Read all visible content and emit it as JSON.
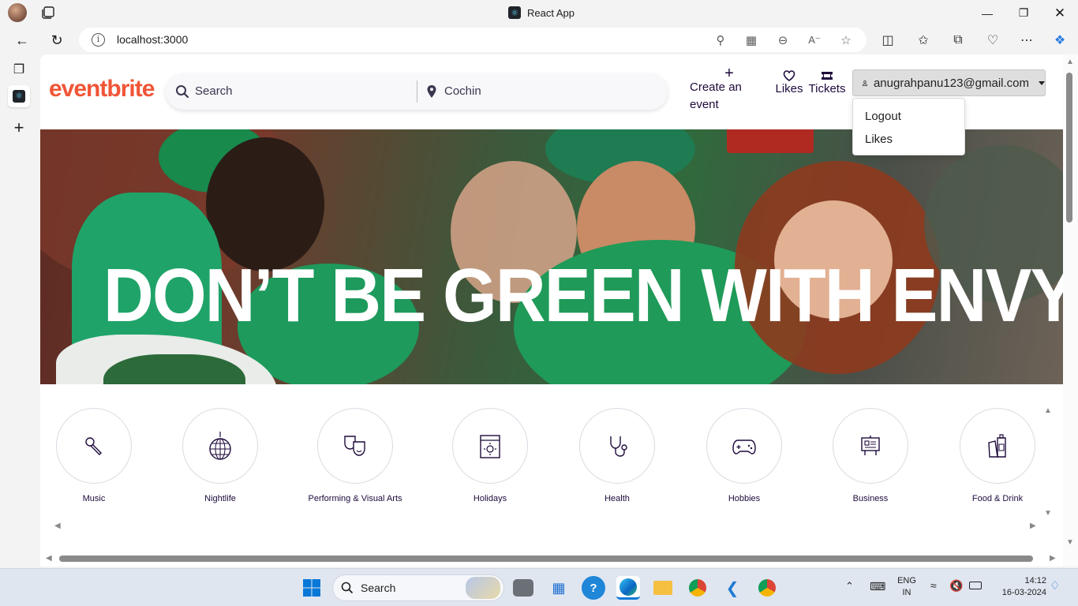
{
  "browser": {
    "tab_title": "React App",
    "url": "localhost:3000"
  },
  "header": {
    "logo": "eventbrite",
    "search_placeholder": "Search",
    "location": "Cochin",
    "create_event": "Create an event",
    "likes": "Likes",
    "tickets": "Tickets",
    "user_email": "anugrahpanu123@gmail.com"
  },
  "dropdown": {
    "items": [
      "Logout",
      "Likes"
    ]
  },
  "hero": {
    "headline": "DON’T BE GREEN WITH ENVY"
  },
  "categories": [
    {
      "label": "Music",
      "icon": "microphone-icon"
    },
    {
      "label": "Nightlife",
      "icon": "disco-ball-icon"
    },
    {
      "label": "Performing & Visual Arts",
      "icon": "theater-masks-icon"
    },
    {
      "label": "Holidays",
      "icon": "calendar-sun-icon"
    },
    {
      "label": "Health",
      "icon": "stethoscope-icon"
    },
    {
      "label": "Hobbies",
      "icon": "gamepad-icon"
    },
    {
      "label": "Business",
      "icon": "presentation-board-icon"
    },
    {
      "label": "Food & Drink",
      "icon": "drinks-icon"
    }
  ],
  "taskbar": {
    "search_label": "Search",
    "language_top": "ENG",
    "language_bottom": "IN",
    "time": "14:12",
    "date": "16-03-2024"
  },
  "colors": {
    "brand": "#f05537",
    "text_dark": "#1e0a3c"
  }
}
